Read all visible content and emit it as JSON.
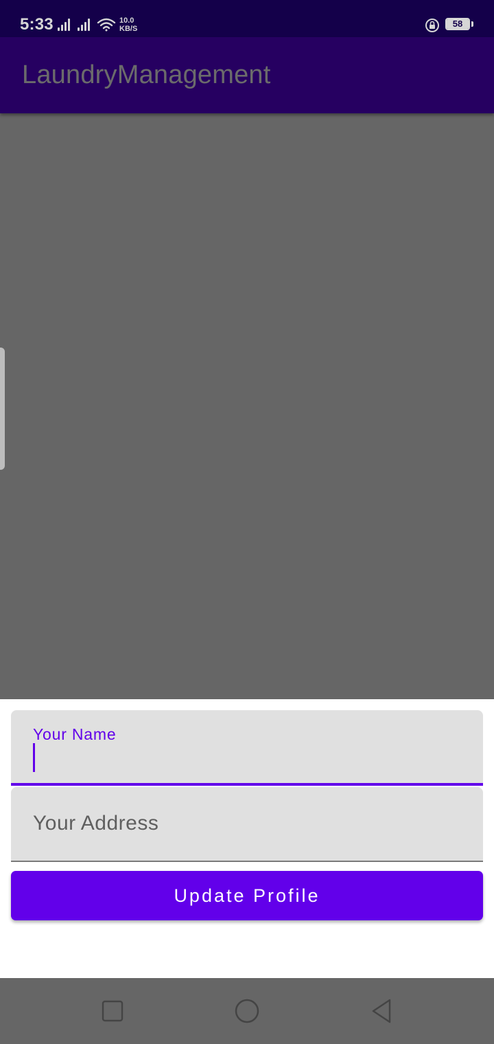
{
  "status_bar": {
    "time": "5:33",
    "net_speed_value": "10.0",
    "net_speed_unit": "KB/S",
    "battery_level": "58",
    "icons": [
      "signal-icon",
      "signal-icon",
      "wifi-icon",
      "rotation-lock-icon",
      "battery-icon"
    ]
  },
  "app_bar": {
    "title": "LaundryManagement"
  },
  "form": {
    "name_label": "Your Name",
    "name_value": "",
    "address_placeholder": "Your Address",
    "address_value": "",
    "submit_label": "Update Profile"
  },
  "nav_bar": {
    "icons": [
      "recents-icon",
      "home-icon",
      "back-icon"
    ]
  },
  "colors": {
    "status_bar": "#14004a",
    "app_bar": "#260061",
    "accent": "#6200ea",
    "scrim": "#666666",
    "field_bg": "#e0e0e0"
  }
}
